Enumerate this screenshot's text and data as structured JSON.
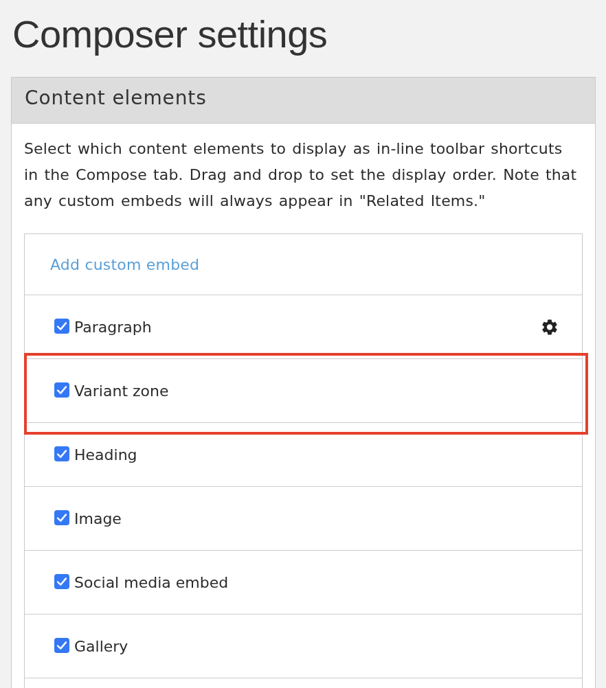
{
  "page": {
    "title": "Composer settings"
  },
  "panel": {
    "title": "Content elements",
    "description": "Select which content elements to display as in-line toolbar shortcuts in the Compose tab. Drag and drop to set the display order. Note that any custom embeds will always appear in \"Related Items.\"",
    "add_link": "Add custom embed",
    "elements": [
      {
        "label": "Paragraph",
        "checked": true,
        "has_settings": true,
        "highlighted": false
      },
      {
        "label": "Variant zone",
        "checked": true,
        "has_settings": false,
        "highlighted": true
      },
      {
        "label": "Heading",
        "checked": true,
        "has_settings": false,
        "highlighted": false
      },
      {
        "label": "Image",
        "checked": true,
        "has_settings": false,
        "highlighted": false
      },
      {
        "label": "Social media embed",
        "checked": true,
        "has_settings": false,
        "highlighted": false
      },
      {
        "label": "Gallery",
        "checked": true,
        "has_settings": false,
        "highlighted": false
      }
    ]
  }
}
